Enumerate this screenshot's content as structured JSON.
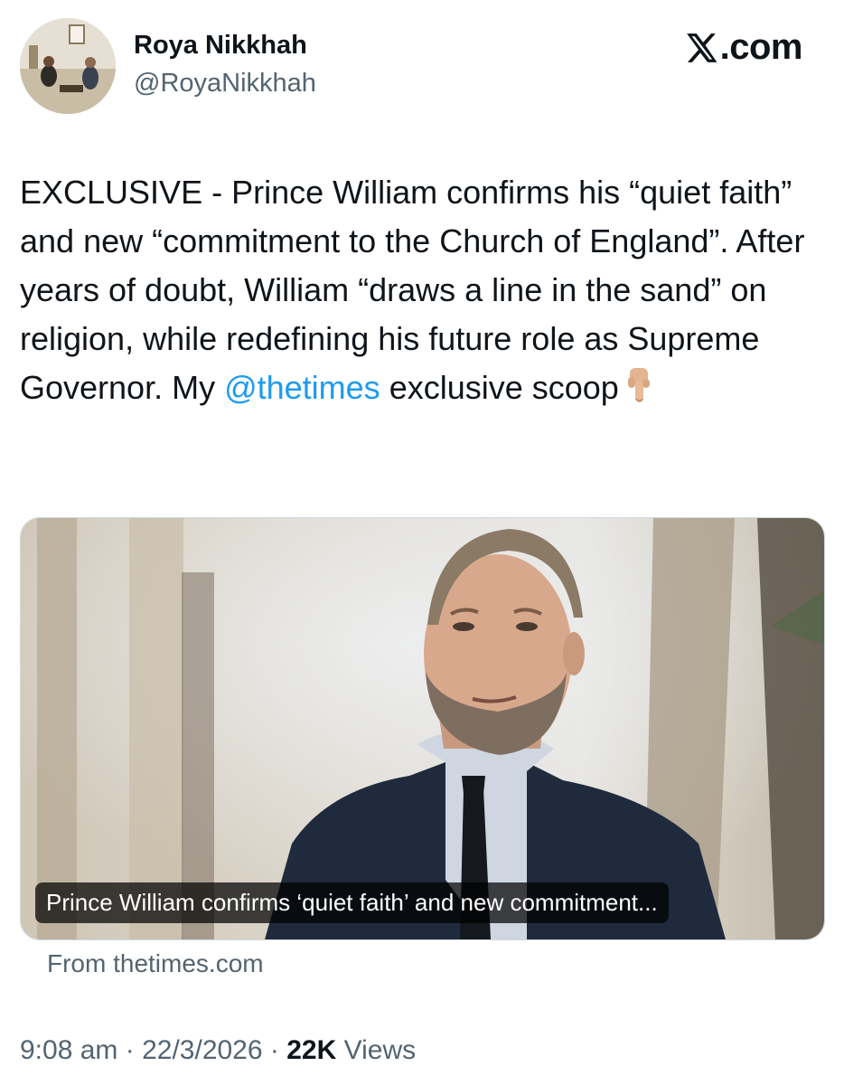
{
  "author": {
    "display_name": "Roya Nikkhah",
    "handle": "@RoyaNikkhah",
    "avatar_icon": "profile-photo"
  },
  "source": {
    "site": ".com",
    "logo_icon": "x-logo-icon"
  },
  "tweet": {
    "text_before": "EXCLUSIVE - Prince William confirms his “quiet faith” and new “commitment to the Church of England”. After years of doubt, William “draws a line in the sand” on religion, while redefining his future role as Supreme Governor. My ",
    "mention": "@thetimes",
    "text_after": " exclusive scoop",
    "emoji_icon": "pointing-down-hand-icon"
  },
  "link_card": {
    "caption": "Prince William confirms ‘quiet faith’ and new commitment...",
    "from": "From thetimes.com"
  },
  "meta": {
    "time": "9:08 am",
    "separator": "·",
    "date": "22/3/2026",
    "views_count": "22K",
    "views_label": "Views"
  },
  "colors": {
    "text": "#0f1419",
    "secondary": "#536471",
    "link": "#1d9bf0"
  }
}
